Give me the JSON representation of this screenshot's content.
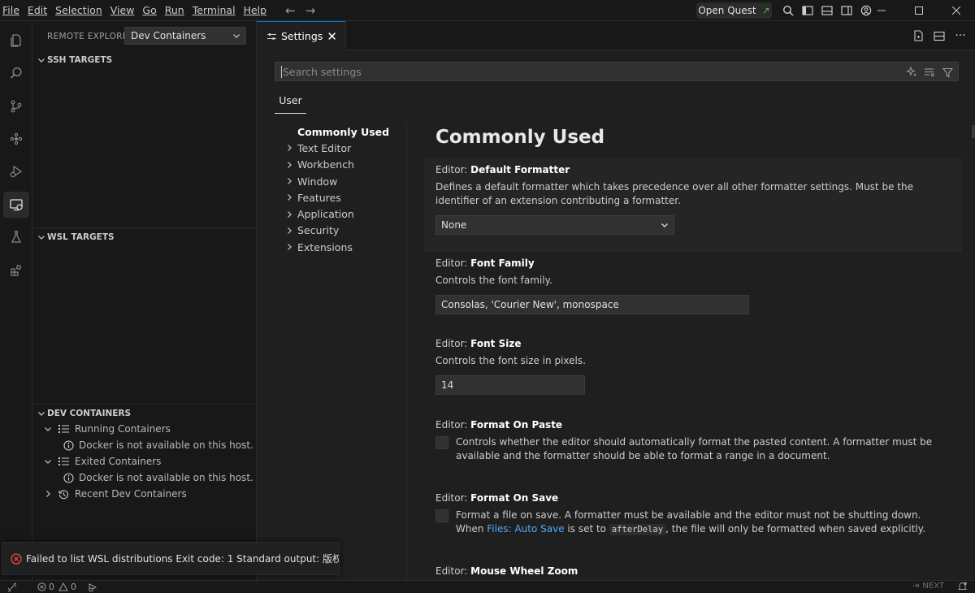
{
  "menu": [
    {
      "id": "file",
      "label": "File"
    },
    {
      "id": "edit",
      "label": "Edit"
    },
    {
      "id": "selection",
      "label": "Selection"
    },
    {
      "id": "view",
      "label": "View"
    },
    {
      "id": "go",
      "label": "Go"
    },
    {
      "id": "run",
      "label": "Run"
    },
    {
      "id": "terminal",
      "label": "Terminal"
    },
    {
      "id": "help",
      "label": "Help"
    }
  ],
  "titlebar": {
    "quest_label": "Open Quest"
  },
  "activity_icons": [
    "explorer-icon",
    "search-icon",
    "source-control-icon",
    "extensions-icon",
    "run-debug-icon",
    "remote-explorer-icon",
    "testing-icon",
    "extensions-grid-icon"
  ],
  "sidebar": {
    "title": "REMOTE EXPLORER",
    "dropdown_value": "Dev Containers",
    "sections": {
      "ssh": "SSH TARGETS",
      "wsl": "WSL TARGETS",
      "dev": "DEV CONTAINERS"
    },
    "dev_items": {
      "running": "Running Containers",
      "running_msg": "Docker is not available on this host.",
      "exited": "Exited Containers",
      "exited_msg": "Docker is not available on this host.",
      "recent": "Recent Dev Containers"
    }
  },
  "editor": {
    "tab_label": "Settings",
    "search_placeholder": "Search settings",
    "scope_tab": "User",
    "toc": {
      "commonly_used": "Commonly Used",
      "items": [
        "Text Editor",
        "Workbench",
        "Window",
        "Features",
        "Application",
        "Security",
        "Extensions"
      ]
    },
    "heading": "Commonly Used",
    "settings": {
      "default_formatter": {
        "category": "Editor: ",
        "name": "Default Formatter",
        "description": "Defines a default formatter which takes precedence over all other formatter settings. Must be the identifier of an extension contributing a formatter.",
        "value": "None"
      },
      "font_family": {
        "category": "Editor: ",
        "name": "Font Family",
        "description": "Controls the font family.",
        "value": "Consolas, 'Courier New', monospace"
      },
      "font_size": {
        "category": "Editor: ",
        "name": "Font Size",
        "description": "Controls the font size in pixels.",
        "value": "14"
      },
      "format_on_paste": {
        "category": "Editor: ",
        "name": "Format On Paste",
        "description": "Controls whether the editor should automatically format the pasted content. A formatter must be available and the formatter should be able to format a range in a document."
      },
      "format_on_save": {
        "category": "Editor: ",
        "name": "Format On Save",
        "desc_before": "Format a file on save. A formatter must be available and the editor must not be shutting down. When ",
        "desc_link": "Files: Auto Save",
        "desc_mid": " is set to ",
        "desc_code": "afterDelay",
        "desc_after": ", the file will only be formatted when saved explicitly."
      },
      "mouse_wheel_zoom": {
        "category": "Editor: ",
        "name": "Mouse Wheel Zoom"
      }
    }
  },
  "notification": {
    "message": "Failed to list WSL distributions Exit code: 1 Standard output: 版权所有 (..."
  },
  "statusbar": {
    "errors": "0",
    "warnings": "0",
    "next_label": "NEXT"
  },
  "colors": {
    "accent": "#0078d4",
    "error": "#f14c4c",
    "quest_arrow": "#3ec13e",
    "link": "#4daafc"
  }
}
